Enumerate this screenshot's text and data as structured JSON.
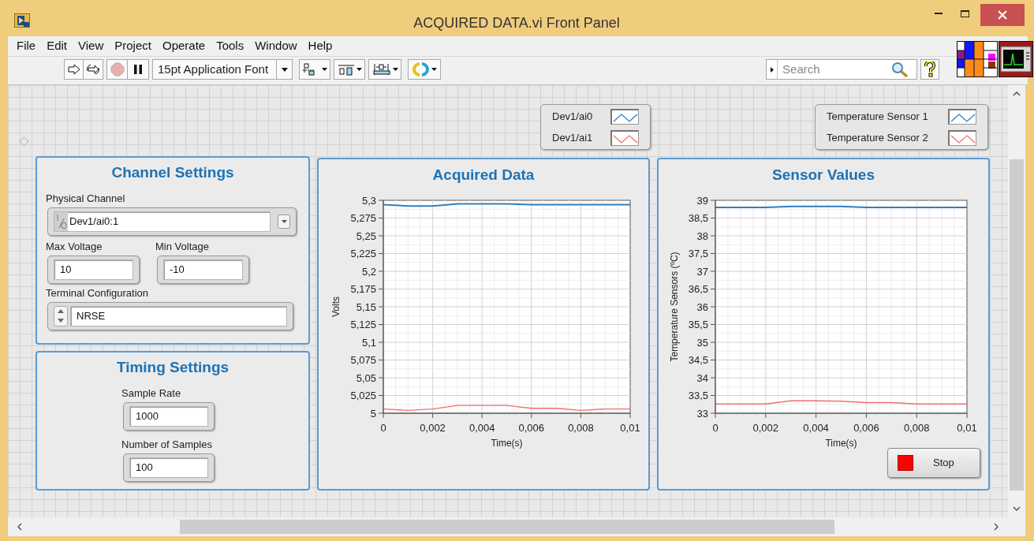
{
  "window": {
    "title": "ACQUIRED DATA.vi Front Panel"
  },
  "menu": [
    "File",
    "Edit",
    "View",
    "Project",
    "Operate",
    "Tools",
    "Window",
    "Help"
  ],
  "toolbar": {
    "font": "15pt Application Font",
    "search": {
      "placeholder": "Search"
    }
  },
  "channel_settings": {
    "title": "Channel Settings",
    "physical_channel": {
      "label": "Physical Channel",
      "value": "Dev1/ai0:1"
    },
    "max_voltage": {
      "label": "Max Voltage",
      "value": "10"
    },
    "min_voltage": {
      "label": "Min Voltage",
      "value": "-10"
    },
    "terminal_configuration": {
      "label": "Terminal Configuration",
      "value": "NRSE"
    }
  },
  "timing_settings": {
    "title": "Timing Settings",
    "sample_rate": {
      "label": "Sample Rate",
      "value": "1000"
    },
    "number_of_samples": {
      "label": "Number of Samples",
      "value": "100"
    }
  },
  "acquired_data": {
    "title": "Acquired Data",
    "chart_data": {
      "type": "line",
      "xlabel": "Time(s)",
      "ylabel": "Volts",
      "x": [
        0,
        0.001,
        0.002,
        0.003,
        0.004,
        0.005,
        0.006,
        0.007,
        0.008,
        0.009,
        0.01
      ],
      "series": [
        {
          "name": "Dev1/ai0",
          "color": "#2f7fc1",
          "values": [
            5.294,
            5.292,
            5.292,
            5.295,
            5.295,
            5.295,
            5.294,
            5.294,
            5.294,
            5.294,
            5.294
          ]
        },
        {
          "name": "Dev1/ai1",
          "color": "#f26d6d",
          "values": [
            5.006,
            5.004,
            5.006,
            5.011,
            5.011,
            5.011,
            5.007,
            5.007,
            5.004,
            5.006,
            5.006
          ]
        }
      ],
      "xlim": [
        0,
        0.01
      ],
      "ylim": [
        5,
        5.3
      ],
      "grid": true,
      "xticks": [
        {
          "value": 0,
          "label": "0"
        },
        {
          "value": 0.002,
          "label": "0,002"
        },
        {
          "value": 0.004,
          "label": "0,004"
        },
        {
          "value": 0.006,
          "label": "0,006"
        },
        {
          "value": 0.008,
          "label": "0,008"
        },
        {
          "value": 0.01,
          "label": "0,01"
        }
      ],
      "yticks": [
        {
          "value": 5,
          "label": "5"
        },
        {
          "value": 5.025,
          "label": "5,025"
        },
        {
          "value": 5.05,
          "label": "5,05"
        },
        {
          "value": 5.075,
          "label": "5,075"
        },
        {
          "value": 5.1,
          "label": "5,1"
        },
        {
          "value": 5.125,
          "label": "5,125"
        },
        {
          "value": 5.15,
          "label": "5,15"
        },
        {
          "value": 5.175,
          "label": "5,175"
        },
        {
          "value": 5.2,
          "label": "5,2"
        },
        {
          "value": 5.225,
          "label": "5,225"
        },
        {
          "value": 5.25,
          "label": "5,25"
        },
        {
          "value": 5.275,
          "label": "5,275"
        },
        {
          "value": 5.3,
          "label": "5,3"
        }
      ]
    }
  },
  "sensor_values": {
    "title": "Sensor Values",
    "chart_data": {
      "type": "line",
      "xlabel": "Time(s)",
      "ylabel": "Temperature Sensors (ºC)",
      "x": [
        0,
        0.001,
        0.002,
        0.003,
        0.004,
        0.005,
        0.006,
        0.007,
        0.008,
        0.009,
        0.01
      ],
      "series": [
        {
          "name": "Temperature Sensor 1",
          "color": "#2f7fc1",
          "values": [
            38.8,
            38.8,
            38.8,
            38.83,
            38.83,
            38.83,
            38.8,
            38.8,
            38.8,
            38.8,
            38.8
          ]
        },
        {
          "name": "Temperature Sensor 2",
          "color": "#f26d6d",
          "values": [
            33.26,
            33.26,
            33.26,
            33.35,
            33.35,
            33.34,
            33.3,
            33.3,
            33.26,
            33.26,
            33.26
          ]
        }
      ],
      "xlim": [
        0,
        0.01
      ],
      "ylim": [
        33,
        39
      ],
      "grid": true,
      "xticks": [
        {
          "value": 0,
          "label": "0"
        },
        {
          "value": 0.002,
          "label": "0,002"
        },
        {
          "value": 0.004,
          "label": "0,004"
        },
        {
          "value": 0.006,
          "label": "0,006"
        },
        {
          "value": 0.008,
          "label": "0,008"
        },
        {
          "value": 0.01,
          "label": "0,01"
        }
      ],
      "yticks": [
        {
          "value": 33,
          "label": "33"
        },
        {
          "value": 33.5,
          "label": "33,5"
        },
        {
          "value": 34,
          "label": "34"
        },
        {
          "value": 34.5,
          "label": "34,5"
        },
        {
          "value": 35,
          "label": "35"
        },
        {
          "value": 35.5,
          "label": "35,5"
        },
        {
          "value": 36,
          "label": "36"
        },
        {
          "value": 36.5,
          "label": "36,5"
        },
        {
          "value": 37,
          "label": "37"
        },
        {
          "value": 37.5,
          "label": "37,5"
        },
        {
          "value": 38,
          "label": "38"
        },
        {
          "value": 38.5,
          "label": "38,5"
        },
        {
          "value": 39,
          "label": "39"
        }
      ]
    },
    "stop_button": {
      "label": "Stop"
    }
  }
}
